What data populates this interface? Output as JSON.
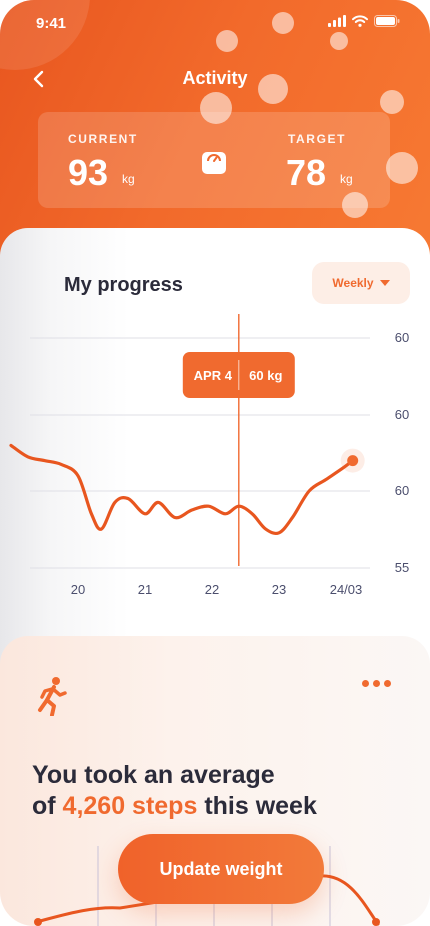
{
  "status_bar": {
    "time": "9:41"
  },
  "header": {
    "title": "Activity",
    "current": {
      "label": "CURRENT",
      "value": "93",
      "unit": "kg"
    },
    "target": {
      "label": "TARGET",
      "value": "78",
      "unit": "kg"
    }
  },
  "progress": {
    "title": "My progress",
    "period": "Weekly",
    "tooltip": {
      "date": "APR 4",
      "value": "60 kg"
    }
  },
  "chart_data": {
    "type": "line",
    "x_tick_labels": [
      "20",
      "21",
      "22",
      "23",
      "24/03"
    ],
    "y_tick_labels": [
      "60",
      "60",
      "60",
      "55"
    ],
    "series": [
      {
        "x": [
          19.0,
          19.25,
          19.5,
          19.75,
          20.0,
          20.2,
          20.35,
          20.55,
          20.75,
          21.0,
          21.2,
          21.45,
          21.7,
          21.95,
          22.2,
          22.4,
          22.6,
          22.8,
          23.0,
          23.2,
          23.45,
          23.7,
          23.95,
          24.1
        ],
        "y": [
          59.2,
          58.9,
          58.8,
          58.7,
          58.4,
          57.4,
          57.0,
          57.7,
          57.8,
          57.4,
          57.7,
          57.3,
          57.5,
          57.6,
          57.4,
          57.6,
          57.4,
          57.0,
          56.9,
          57.3,
          58.0,
          58.3,
          58.6,
          58.8
        ]
      }
    ],
    "highlight_x": 22.4,
    "grid": true
  },
  "steps": {
    "line1": "You took an average",
    "line2_prefix": "of ",
    "highlight": "4,260 steps",
    "line2_suffix": " this week"
  },
  "actions": {
    "update_weight": "Update weight"
  },
  "colors": {
    "accent": "#f06a2f",
    "header_start": "#e8561f",
    "header_end": "#f77a33",
    "text_dark": "#2b2b3a"
  }
}
